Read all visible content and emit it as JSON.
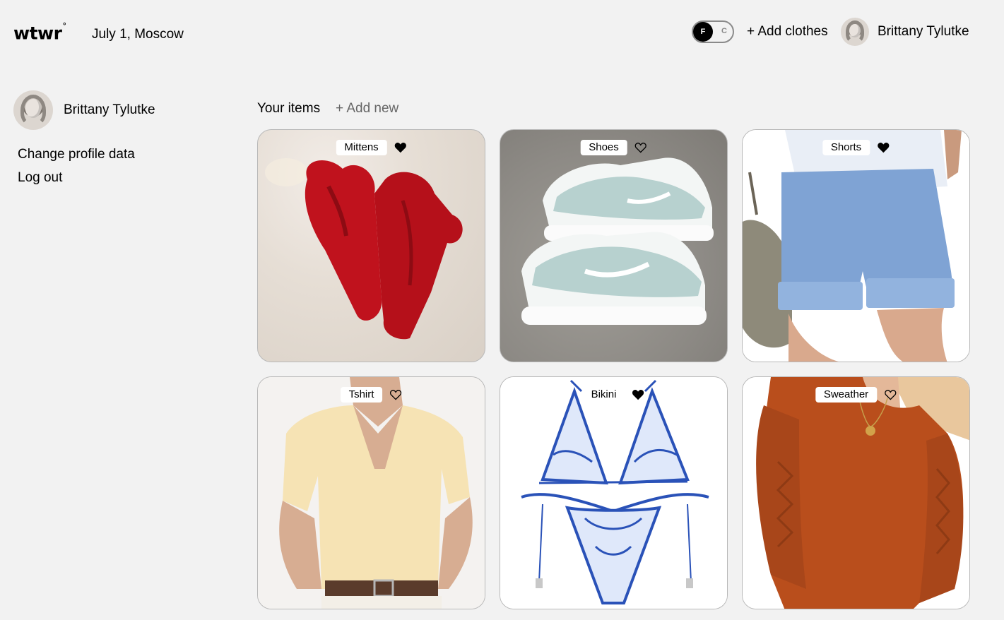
{
  "header": {
    "logo": "wtwr",
    "logo_mark": "°",
    "date_location": "July 1, Moscow",
    "toggle": {
      "on_label": "F",
      "off_label": "C",
      "selected": "F"
    },
    "add_clothes_label": "+ Add clothes",
    "username": "Brittany Tylutke"
  },
  "sidebar": {
    "username": "Brittany Tylutke",
    "change_profile_label": "Change profile data",
    "logout_label": "Log out"
  },
  "items_section": {
    "title": "Your items",
    "add_new_label": "+ Add new",
    "items": [
      {
        "name": "Mittens",
        "liked": true
      },
      {
        "name": "Shoes",
        "liked": false
      },
      {
        "name": "Shorts",
        "liked": true
      },
      {
        "name": "Tshirt",
        "liked": false
      },
      {
        "name": "Bikini",
        "liked": true
      },
      {
        "name": "Sweather",
        "liked": false
      }
    ]
  },
  "colors": {
    "background": "#f2f2f2",
    "text": "#000000",
    "muted": "#666666",
    "card_border": "#b8b8b8"
  }
}
